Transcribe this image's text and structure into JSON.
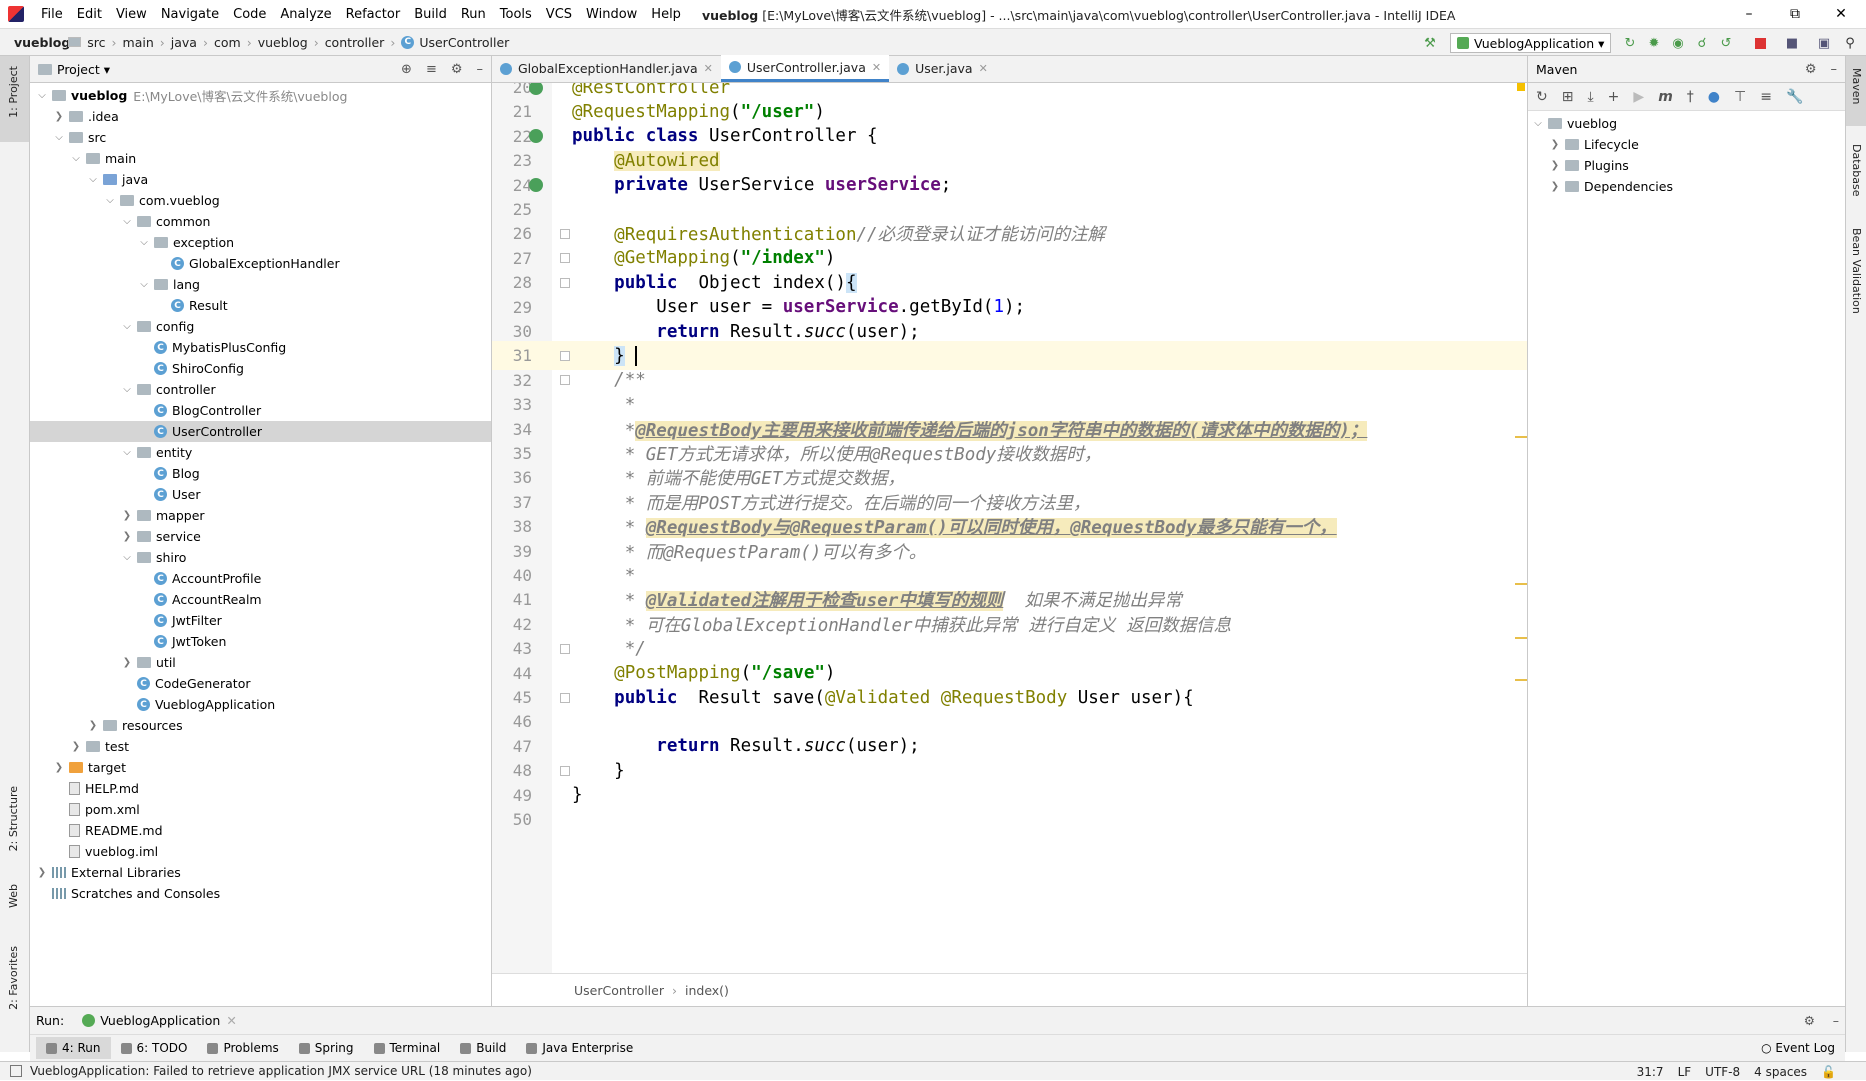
{
  "titlebar": {
    "menu": [
      "File",
      "Edit",
      "View",
      "Navigate",
      "Code",
      "Analyze",
      "Refactor",
      "Build",
      "Run",
      "Tools",
      "VCS",
      "Window",
      "Help"
    ],
    "project": "vueblog",
    "path": "[E:\\MyLove\\博客\\云文件系统\\vueblog] - ...\\src\\main\\java\\com\\vueblog\\controller\\UserController.java - IntelliJ IDEA"
  },
  "navbar": {
    "crumbs": [
      "vueblog",
      "src",
      "main",
      "java",
      "com",
      "vueblog",
      "controller",
      "UserController"
    ],
    "run_config": "VueblogApplication"
  },
  "left_stripe": {
    "project": "1: Project",
    "structure": "2: Structure",
    "web": "Web",
    "favorites": "2: Favorites"
  },
  "right_stripe": {
    "maven": "Maven",
    "database": "Database",
    "bean": "Bean Validation"
  },
  "project_panel": {
    "title": "Project",
    "tree": [
      {
        "label": "vueblog",
        "extra": "E:\\MyLove\\博客\\云文件系统\\vueblog",
        "depth": 0,
        "type": "folder",
        "expanded": true,
        "bold": true
      },
      {
        "label": ".idea",
        "depth": 1,
        "type": "folder",
        "expanded": false
      },
      {
        "label": "src",
        "depth": 1,
        "type": "folder",
        "expanded": true
      },
      {
        "label": "main",
        "depth": 2,
        "type": "folder",
        "expanded": true
      },
      {
        "label": "java",
        "depth": 3,
        "type": "folder-blue",
        "expanded": true
      },
      {
        "label": "com.vueblog",
        "depth": 4,
        "type": "folder",
        "expanded": true
      },
      {
        "label": "common",
        "depth": 5,
        "type": "folder",
        "expanded": true
      },
      {
        "label": "exception",
        "depth": 6,
        "type": "folder",
        "expanded": true
      },
      {
        "label": "GlobalExceptionHandler",
        "depth": 7,
        "type": "class"
      },
      {
        "label": "lang",
        "depth": 6,
        "type": "folder",
        "expanded": true
      },
      {
        "label": "Result",
        "depth": 7,
        "type": "class"
      },
      {
        "label": "config",
        "depth": 5,
        "type": "folder",
        "expanded": true
      },
      {
        "label": "MybatisPlusConfig",
        "depth": 6,
        "type": "class"
      },
      {
        "label": "ShiroConfig",
        "depth": 6,
        "type": "class"
      },
      {
        "label": "controller",
        "depth": 5,
        "type": "folder",
        "expanded": true
      },
      {
        "label": "BlogController",
        "depth": 6,
        "type": "class"
      },
      {
        "label": "UserController",
        "depth": 6,
        "type": "class",
        "selected": true
      },
      {
        "label": "entity",
        "depth": 5,
        "type": "folder",
        "expanded": true
      },
      {
        "label": "Blog",
        "depth": 6,
        "type": "class"
      },
      {
        "label": "User",
        "depth": 6,
        "type": "class"
      },
      {
        "label": "mapper",
        "depth": 5,
        "type": "folder",
        "expanded": false
      },
      {
        "label": "service",
        "depth": 5,
        "type": "folder",
        "expanded": false
      },
      {
        "label": "shiro",
        "depth": 5,
        "type": "folder",
        "expanded": true
      },
      {
        "label": "AccountProfile",
        "depth": 6,
        "type": "class"
      },
      {
        "label": "AccountRealm",
        "depth": 6,
        "type": "class"
      },
      {
        "label": "JwtFilter",
        "depth": 6,
        "type": "class"
      },
      {
        "label": "JwtToken",
        "depth": 6,
        "type": "class"
      },
      {
        "label": "util",
        "depth": 5,
        "type": "folder",
        "expanded": false
      },
      {
        "label": "CodeGenerator",
        "depth": 5,
        "type": "class"
      },
      {
        "label": "VueblogApplication",
        "depth": 5,
        "type": "class"
      },
      {
        "label": "resources",
        "depth": 3,
        "type": "folder",
        "expanded": false
      },
      {
        "label": "test",
        "depth": 2,
        "type": "folder",
        "expanded": false
      },
      {
        "label": "target",
        "depth": 1,
        "type": "folder-orange",
        "expanded": false
      },
      {
        "label": "HELP.md",
        "depth": 1,
        "type": "file"
      },
      {
        "label": "pom.xml",
        "depth": 1,
        "type": "file"
      },
      {
        "label": "README.md",
        "depth": 1,
        "type": "file"
      },
      {
        "label": "vueblog.iml",
        "depth": 1,
        "type": "file"
      },
      {
        "label": "External Libraries",
        "depth": 0,
        "type": "lib",
        "expanded": false
      },
      {
        "label": "Scratches and Consoles",
        "depth": 0,
        "type": "lib"
      }
    ]
  },
  "editor": {
    "tabs": [
      {
        "label": "GlobalExceptionHandler.java",
        "active": false
      },
      {
        "label": "UserController.java",
        "active": true
      },
      {
        "label": "User.java",
        "active": false
      }
    ],
    "lines": [
      {
        "n": "20",
        "html": "<span class='ann'>@RestController</span>"
      },
      {
        "n": "21",
        "html": "<span class='ann'>@RequestMapping</span>(<span class='str'>\"/user\"</span>)"
      },
      {
        "n": "22",
        "html": "<span class='kw'>public class</span> UserController {"
      },
      {
        "n": "23",
        "html": "    <span class='ann hl'>@Autowired</span>"
      },
      {
        "n": "24",
        "html": "    <span class='kw'>private</span> UserService <span class='field'>userService</span>;"
      },
      {
        "n": "25",
        "html": ""
      },
      {
        "n": "26",
        "html": "    <span class='ann'>@RequiresAuthentication</span><span class='cmt'>//必须登录认证才能访问的注解</span>"
      },
      {
        "n": "27",
        "html": "    <span class='ann'>@GetMapping</span>(<span class='str'>\"/index\"</span>)"
      },
      {
        "n": "28",
        "html": "    <span class='kw'>public</span>  Object index()<span style='background:#cce4f7'>{</span>"
      },
      {
        "n": "29",
        "html": "        User user = <span class='field'>userService</span>.getById(<span class='num'>1</span>);"
      },
      {
        "n": "30",
        "html": "        <span class='kw'>return</span> Result.<i>succ</i>(user);"
      },
      {
        "n": "31",
        "html": "    <span style='background:#cce4f7'>}</span> <span class='caret'></span>"
      },
      {
        "n": "32",
        "html": "    <span class='doc'>/**</span>"
      },
      {
        "n": "33",
        "html": "     <span class='doc'>*</span>"
      },
      {
        "n": "34",
        "html": "     <span class='doc'>*<span class='hl' style='text-decoration:underline'><b>@RequestBody主要用来接收前端传递给后端的json字符串中的数据的(请求体中的数据的)；</b></span></span>"
      },
      {
        "n": "35",
        "html": "     <span class='doc'>* GET方式无请求体，所以使用@RequestBody接收数据时，</span>"
      },
      {
        "n": "36",
        "html": "     <span class='doc'>* 前端不能使用GET方式提交数据，</span>"
      },
      {
        "n": "37",
        "html": "     <span class='doc'>* 而是用POST方式进行提交。在后端的同一个接收方法里，</span>"
      },
      {
        "n": "38",
        "html": "     <span class='doc'>* <span class='hl' style='text-decoration:underline'><b>@RequestBody与@RequestParam()可以同时使用，@RequestBody最多只能有一个，</b></span></span>"
      },
      {
        "n": "39",
        "html": "     <span class='doc'>* 而@RequestParam()可以有多个。</span>"
      },
      {
        "n": "40",
        "html": "     <span class='doc'>*</span>"
      },
      {
        "n": "41",
        "html": "     <span class='doc'>* <span class='hl' style='text-decoration:underline'><b>@Validated注解用于检查user中填写的规则</b></span>  如果不满足抛出异常</span>"
      },
      {
        "n": "42",
        "html": "     <span class='doc'>* 可在GlobalExceptionHandler中捕获此异常 进行自定义 返回数据信息</span>"
      },
      {
        "n": "43",
        "html": "     <span class='doc'>*/</span>"
      },
      {
        "n": "44",
        "html": "    <span class='ann'>@PostMapping</span>(<span class='str'>\"/save\"</span>)"
      },
      {
        "n": "45",
        "html": "    <span class='kw'>public</span>  Result save(<span class='ann'>@Validated</span> <span class='ann'>@RequestBody</span> User user){"
      },
      {
        "n": "46",
        "html": ""
      },
      {
        "n": "47",
        "html": "        <span class='kw'>return</span> Result.<i>succ</i>(user);"
      },
      {
        "n": "48",
        "html": "    }"
      },
      {
        "n": "49",
        "html": "}"
      },
      {
        "n": "50",
        "html": ""
      }
    ],
    "breadcrumbs": [
      "UserController",
      "index()"
    ]
  },
  "maven": {
    "title": "Maven",
    "tree": [
      {
        "label": "vueblog",
        "depth": 0,
        "expanded": true
      },
      {
        "label": "Lifecycle",
        "depth": 1,
        "expanded": false
      },
      {
        "label": "Plugins",
        "depth": 1,
        "expanded": false
      },
      {
        "label": "Dependencies",
        "depth": 1,
        "expanded": false
      }
    ]
  },
  "runbar": {
    "label": "Run:",
    "config": "VueblogApplication"
  },
  "bottom_tabs": [
    "4: Run",
    "6: TODO",
    "Problems",
    "Spring",
    "Terminal",
    "Build",
    "Java Enterprise"
  ],
  "event_log": "Event Log",
  "status": {
    "message": "VueblogApplication: Failed to retrieve application JMX service URL (18 minutes ago)",
    "position": "31:7",
    "line_sep": "LF",
    "encoding": "UTF-8",
    "indent": "4 spaces"
  }
}
